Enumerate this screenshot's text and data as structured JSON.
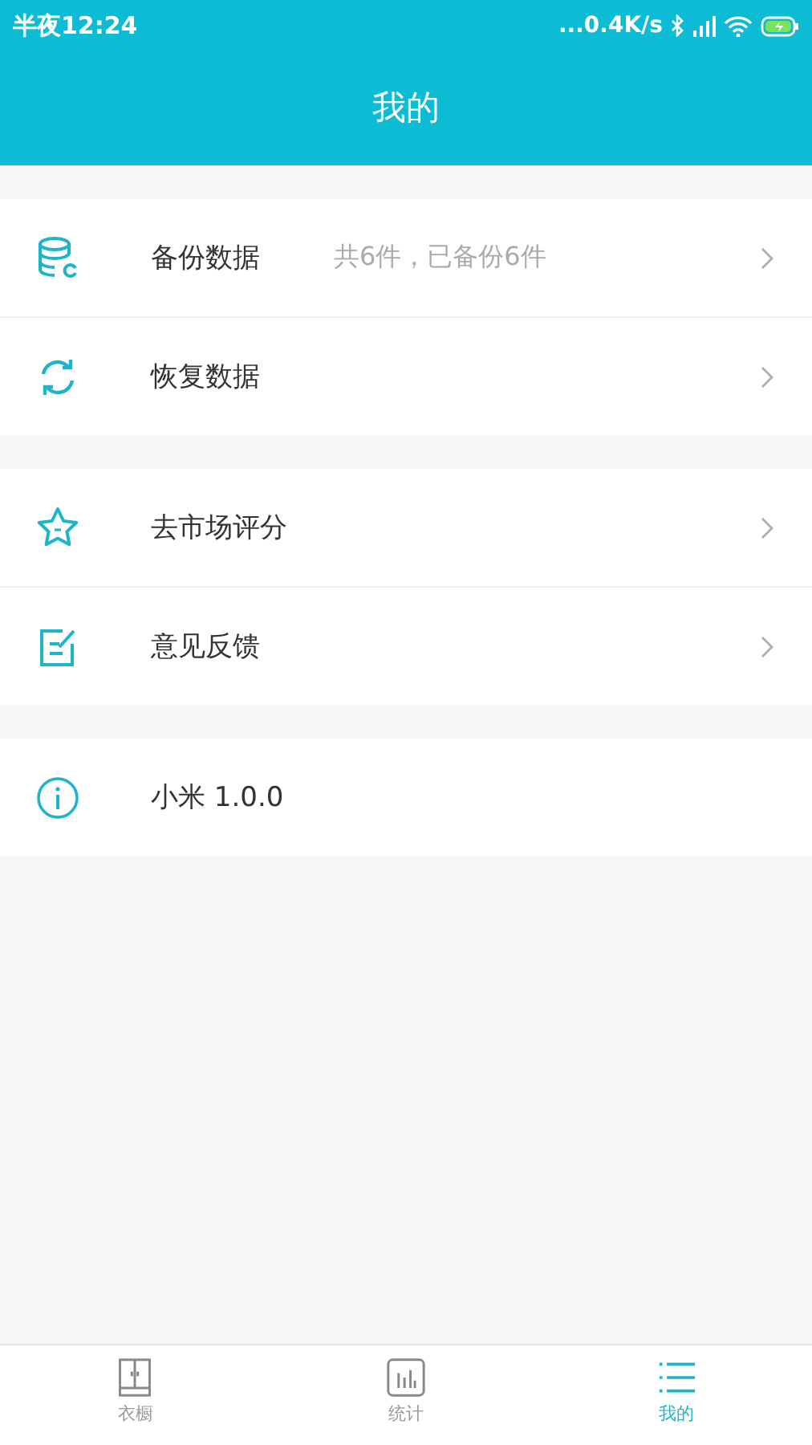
{
  "status_bar": {
    "time": "半夜12:24",
    "speed": "...0.4K/s"
  },
  "header": {
    "title": "我的"
  },
  "sections": [
    {
      "items": [
        {
          "kind": "database",
          "label": "备份数据",
          "detail": "共6件，已备份6件"
        },
        {
          "kind": "sync",
          "label": "恢复数据"
        }
      ]
    },
    {
      "items": [
        {
          "kind": "star",
          "label": "去市场评分"
        },
        {
          "kind": "edit",
          "label": "意见反馈"
        }
      ]
    },
    {
      "items": [
        {
          "kind": "info",
          "label": "小米 1.0.0"
        }
      ]
    }
  ],
  "tabs": [
    {
      "kind": "wardrobe",
      "label": "衣橱",
      "selected": false
    },
    {
      "kind": "chart",
      "label": "统计",
      "selected": false
    },
    {
      "kind": "list",
      "label": "我的",
      "selected": true
    }
  ]
}
